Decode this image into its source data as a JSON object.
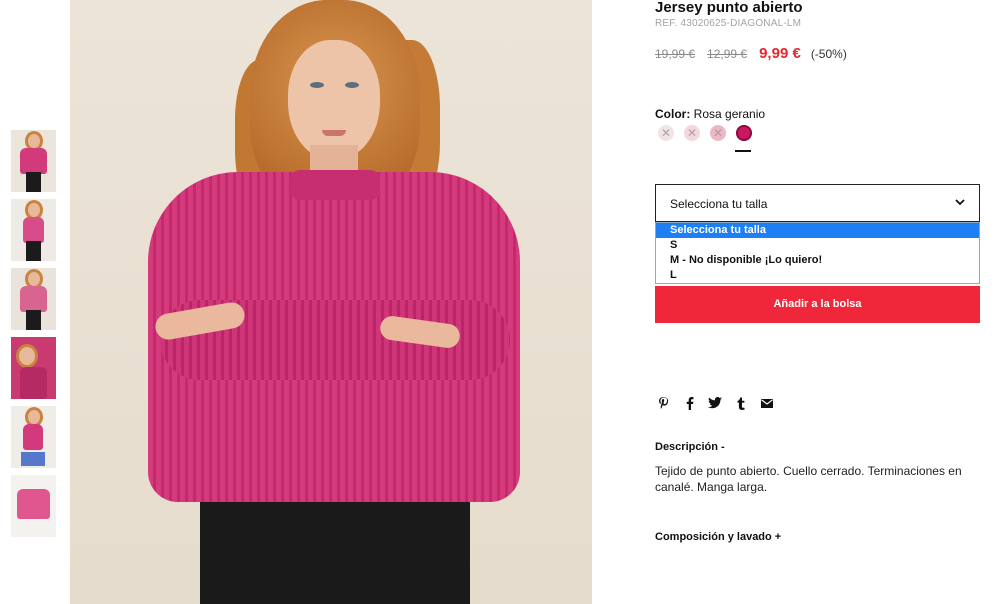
{
  "product": {
    "title": "Jersey punto abierto",
    "ref": "REF. 43020625-DIAGONAL-LM",
    "prices": {
      "original": "19,99 €",
      "previous": "12,99 €",
      "current": "9,99 €",
      "discount": "(-50%)"
    }
  },
  "color": {
    "label": "Color:",
    "value": "Rosa geranio",
    "swatches": [
      {
        "color": "#f1e4e6",
        "available": false
      },
      {
        "color": "#f3d7dd",
        "available": false
      },
      {
        "color": "#eeb7c6",
        "available": false
      },
      {
        "color": "#c8185f",
        "available": true,
        "selected": true
      }
    ]
  },
  "size": {
    "placeholder": "Selecciona tu talla",
    "options": [
      "Selecciona tu talla",
      "S",
      "M - No disponible ¡Lo quiero!",
      "L"
    ]
  },
  "add_to_bag": "Añadir a la bolsa",
  "social": [
    "pinterest-icon",
    "facebook-icon",
    "twitter-icon",
    "tumblr-icon",
    "mail-icon"
  ],
  "description": {
    "heading": "Descripción -",
    "text": "Tejido de punto abierto. Cuello cerrado. Terminaciones en canalé. Manga larga."
  },
  "composition": {
    "heading": "Composición y lavado +"
  },
  "colors": {
    "accent": "#f0263a",
    "price_red": "#e8252f",
    "sweater": "#d43a7c",
    "dropdown_highlight": "#1e7ff5"
  }
}
